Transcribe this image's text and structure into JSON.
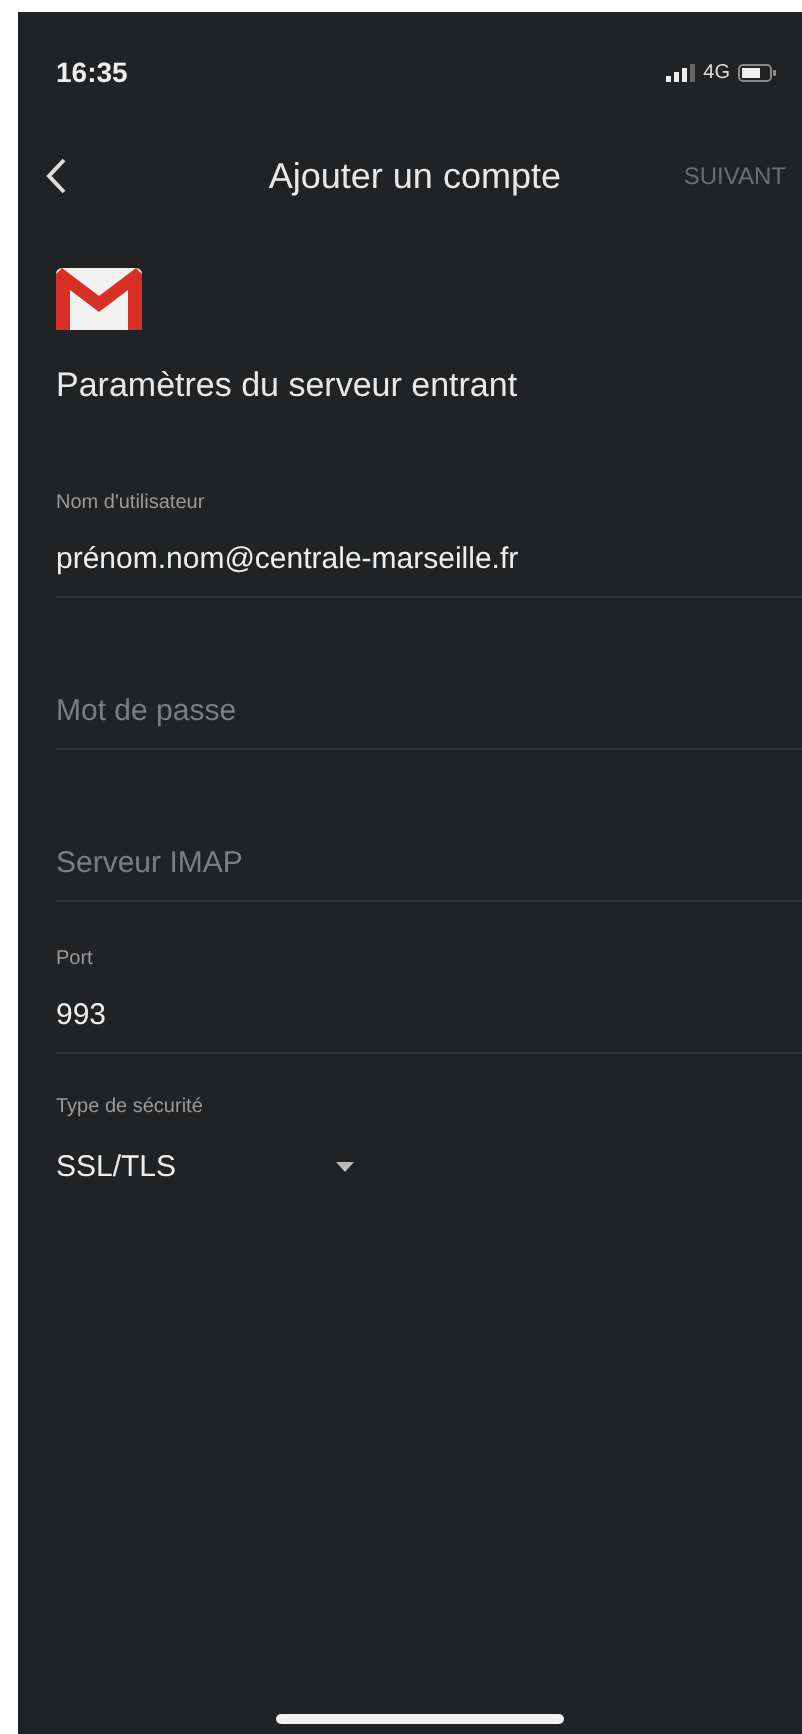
{
  "status_bar": {
    "time": "16:35",
    "network": "4G"
  },
  "nav": {
    "title": "Ajouter un compte",
    "action": {
      "label": "SUIVANT",
      "disabled": true
    }
  },
  "section_title": "Paramètres du serveur entrant",
  "fields": [
    {
      "kind": "text",
      "label": "Nom d'utilisateur",
      "value": "prénom.nom@centrale-marseille.fr"
    },
    {
      "kind": "text",
      "placeholder": "Mot de passe"
    },
    {
      "kind": "text",
      "placeholder": "Serveur IMAP"
    },
    {
      "kind": "text",
      "label": "Port",
      "value": "993"
    },
    {
      "kind": "select",
      "label": "Type de sécurité",
      "value": "SSL/TLS"
    }
  ]
}
